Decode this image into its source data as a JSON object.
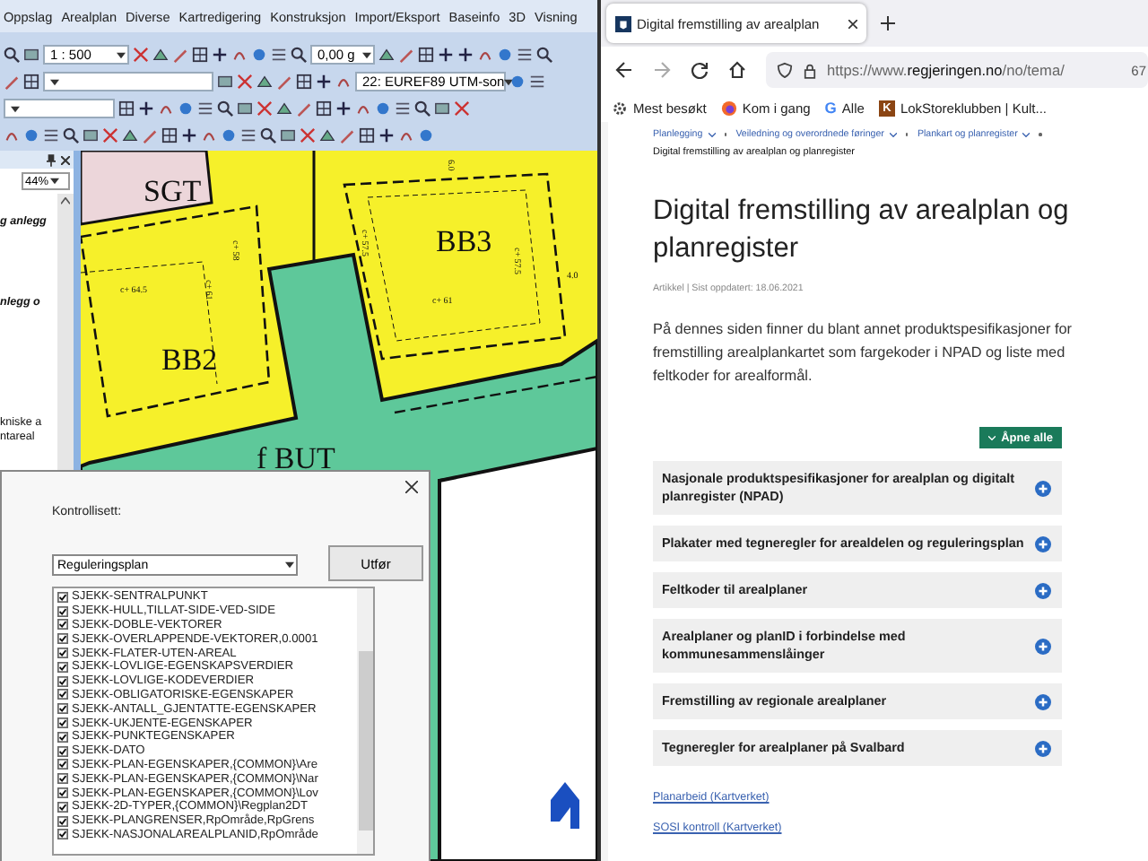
{
  "cad": {
    "menu": [
      "Oppslag",
      "Arealplan",
      "Diverse",
      "Kartredigering",
      "Konstruksjon",
      "Import/Eksport",
      "Baseinfo",
      "3D",
      "Visning"
    ],
    "scale": "1 : 500",
    "angle": "0,00 g",
    "projection": "22: EUREF89 UTM-son",
    "zoom": "44%",
    "panel_texts": [
      {
        "text": "g anlegg",
        "kind": "heading"
      },
      {
        "text": "nlegg o",
        "kind": "heading"
      },
      {
        "text": "kniske a",
        "kind": "body"
      },
      {
        "text": "ntareal",
        "kind": "body"
      }
    ],
    "map_labels": [
      {
        "text": "SGT",
        "kind": "zone"
      },
      {
        "text": "BB3",
        "kind": "zone"
      },
      {
        "text": "BB2",
        "kind": "zone"
      },
      {
        "text": "f BUT",
        "kind": "zone"
      },
      {
        "text": "c+ 64.5",
        "kind": "height"
      },
      {
        "text": "c+ 61",
        "kind": "height"
      },
      {
        "text": "c+ 58",
        "kind": "height"
      },
      {
        "text": "c+ 57.5",
        "kind": "height"
      },
      {
        "text": "c+ 61",
        "kind": "height"
      },
      {
        "text": "c+ 57.5",
        "kind": "height"
      },
      {
        "text": "4.0",
        "kind": "height"
      },
      {
        "text": "6.0",
        "kind": "height"
      }
    ]
  },
  "dialog": {
    "label": "Kontrollisett:",
    "select": "Reguleringsplan",
    "run_button": "Utfør",
    "checks": [
      {
        "label": "SJEKK-SENTRALPUNKT",
        "checked": true
      },
      {
        "label": "SJEKK-HULL,TILLAT-SIDE-VED-SIDE",
        "checked": true
      },
      {
        "label": "SJEKK-DOBLE-VEKTORER",
        "checked": true
      },
      {
        "label": "SJEKK-OVERLAPPENDE-VEKTORER,0.0001",
        "checked": true
      },
      {
        "label": "SJEKK-FLATER-UTEN-AREAL",
        "checked": true
      },
      {
        "label": "SJEKK-LOVLIGE-EGENSKAPSVERDIER",
        "checked": true
      },
      {
        "label": "SJEKK-LOVLIGE-KODEVERDIER",
        "checked": true
      },
      {
        "label": "SJEKK-OBLIGATORISKE-EGENSKAPER",
        "checked": true
      },
      {
        "label": "SJEKK-ANTALL_GJENTATTE-EGENSKAPER",
        "checked": true
      },
      {
        "label": "SJEKK-UKJENTE-EGENSKAPER",
        "checked": true
      },
      {
        "label": "SJEKK-PUNKTEGENSKAPER",
        "checked": true
      },
      {
        "label": "SJEKK-DATO",
        "checked": true
      },
      {
        "label": "SJEKK-PLAN-EGENSKAPER,{COMMON}\\Are",
        "checked": true
      },
      {
        "label": "SJEKK-PLAN-EGENSKAPER,{COMMON}\\Nar",
        "checked": true
      },
      {
        "label": "SJEKK-PLAN-EGENSKAPER,{COMMON}\\Lov",
        "checked": true
      },
      {
        "label": "SJEKK-2D-TYPER,{COMMON}\\Regplan2DT",
        "checked": true
      },
      {
        "label": "SJEKK-PLANGRENSER,RpOmråde,RpGrens",
        "checked": true
      },
      {
        "label": "SJEKK-NASJONALAREALPLANID,RpOmråde",
        "checked": true
      }
    ]
  },
  "browser": {
    "tab": {
      "title": "Digital fremstilling av arealplan",
      "selected": true
    },
    "url": {
      "prefix": "https://www.",
      "host": "regjeringen.no",
      "path": "/no/tema/",
      "suffix": "67"
    },
    "bookmarks": [
      {
        "label": "Mest besøkt",
        "kind": "gear"
      },
      {
        "label": "Kom i gang",
        "kind": "globe"
      },
      {
        "label": "Alle",
        "kind": "letter",
        "icon_text": "G"
      },
      {
        "label": "LokStoreklubben | Kult...",
        "kind": "badge",
        "icon_text": "K"
      }
    ],
    "page": {
      "breadcrumbs": [
        "Planlegging",
        "Veiledning og overordnede føringer",
        "Plankart og planregister"
      ],
      "current": "Digital fremstilling av arealplan og planregister",
      "title": "Digital fremstilling av arealplan og planregister",
      "meta": "Artikkel | Sist oppdatert: 18.06.2021",
      "intro": "På dennes siden finner du blant annet produktspesifikasjoner for fremstilling arealplankartet som fargekoder i NPAD og liste med feltkoder for arealformål.",
      "expand_button": "Åpne alle",
      "accordions": [
        {
          "title": "Nasjonale produktspesifikasjoner for arealplan og digitalt planregister (NPAD)",
          "expanded": false
        },
        {
          "title": "Plakater med tegneregler for arealdelen og reguleringsplan",
          "expanded": false
        },
        {
          "title": "Feltkoder til arealplaner",
          "expanded": false
        },
        {
          "title": "Arealplaner og planID i forbindelse med kommunesammenslåinger",
          "expanded": false
        },
        {
          "title": "Fremstilling av regionale arealplaner",
          "expanded": false
        },
        {
          "title": "Tegneregler for arealplaner på Svalbard",
          "expanded": false
        }
      ],
      "links": [
        "Planarbeid (Kartverket)",
        "SOSI kontroll (Kartverket)"
      ]
    }
  }
}
